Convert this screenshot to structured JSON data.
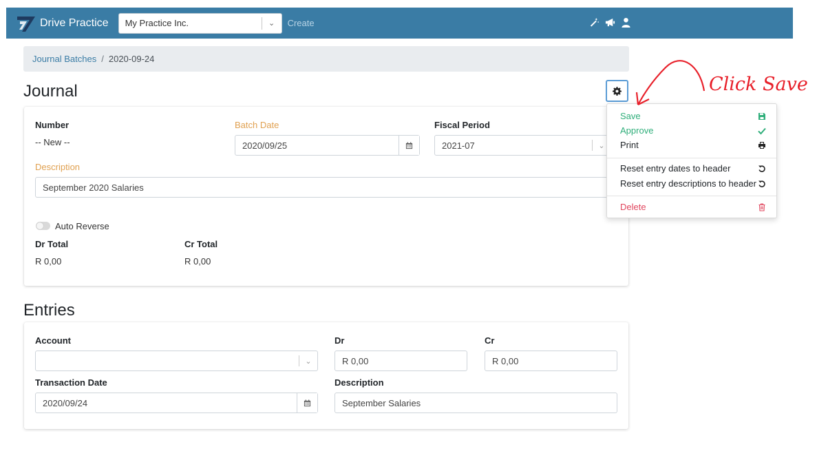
{
  "navbar": {
    "brand": "Drive Practice",
    "company": "My Practice Inc.",
    "create": "Create",
    "icons": [
      "magic-wand-icon",
      "megaphone-icon",
      "user-icon"
    ],
    "color": "#3a7ca5"
  },
  "breadcrumb": {
    "link": "Journal Batches",
    "separator": "/",
    "current": "2020-09-24"
  },
  "journal": {
    "title": "Journal",
    "number_label": "Number",
    "number_value": "-- New --",
    "batch_date_label": "Batch Date",
    "batch_date_value": "2020/09/25",
    "fiscal_period_label": "Fiscal Period",
    "fiscal_period_value": "2021-07",
    "description_label": "Description",
    "description_value": "September 2020 Salaries",
    "auto_reverse_label": "Auto Reverse",
    "dr_total_label": "Dr Total",
    "dr_total_value": "R 0,00",
    "cr_total_label": "Cr Total",
    "cr_total_value": "R 0,00"
  },
  "entries": {
    "title": "Entries",
    "account_label": "Account",
    "account_value": "",
    "dr_label": "Dr",
    "dr_value": "R 0,00",
    "cr_label": "Cr",
    "cr_value": "R 0,00",
    "transaction_date_label": "Transaction Date",
    "transaction_date_value": "2020/09/24",
    "description_label": "Description",
    "description_value": "September Salaries"
  },
  "dropdown": {
    "items": [
      {
        "label": "Save",
        "icon": "save-icon",
        "color": "#2fae7a"
      },
      {
        "label": "Approve",
        "icon": "check-icon",
        "color": "#2fae7a"
      },
      {
        "label": "Print",
        "icon": "print-icon"
      },
      {
        "label": "Reset entry dates to header",
        "icon": "undo-icon"
      },
      {
        "label": "Reset entry descriptions to header",
        "icon": "undo-icon"
      },
      {
        "label": "Delete",
        "icon": "trash-icon",
        "color": "#e0465e"
      }
    ]
  },
  "annotation": {
    "text": "Click Save",
    "color": "#e8202a"
  }
}
